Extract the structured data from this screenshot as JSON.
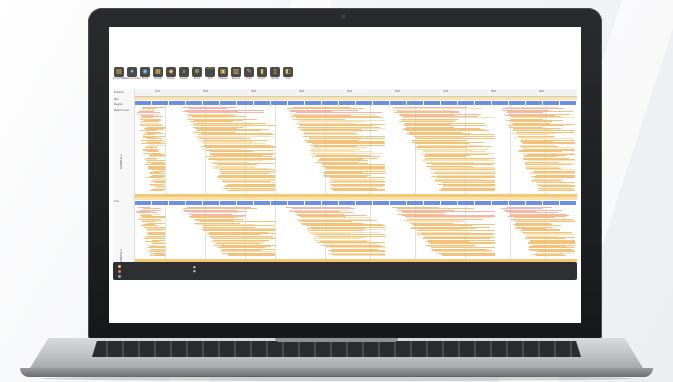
{
  "app": {
    "toolbar": [
      {
        "label": "Drug Files",
        "icon": "drug-files-icon",
        "glyph": "▤",
        "blue": false
      },
      {
        "label": "Reference Files",
        "icon": "reference-files-icon",
        "glyph": "●",
        "blue": true
      },
      {
        "label": "Scroll",
        "icon": "scroll-icon",
        "glyph": "◉",
        "blue": true
      },
      {
        "label": "Reads",
        "icon": "reads-icon",
        "glyph": "▦",
        "blue": false
      },
      {
        "label": "Screen",
        "icon": "screen-icon",
        "glyph": "◆",
        "blue": false
      },
      {
        "label": "Search",
        "icon": "search-icon",
        "glyph": "⌕",
        "blue": false
      },
      {
        "label": "Zoom",
        "icon": "zoom-icon",
        "glyph": "⊕",
        "blue": false
      },
      {
        "label": "Sort",
        "icon": "sort-icon",
        "glyph": "⌒",
        "blue": false
      },
      {
        "label": "Collapse",
        "icon": "collapse-icon",
        "glyph": "▣",
        "blue": false
      },
      {
        "label": "Expand",
        "icon": "expand-icon",
        "glyph": "▥",
        "blue": false
      },
      {
        "label": "Tools",
        "icon": "tools-icon",
        "glyph": "✎",
        "blue": false
      },
      {
        "label": "Export",
        "icon": "export-icon",
        "glyph": "▮",
        "blue": false
      },
      {
        "label": "Options",
        "icon": "options-icon",
        "glyph": "▯",
        "blue": false
      },
      {
        "label": "Help",
        "icon": "help-icon",
        "glyph": "◧",
        "blue": false
      }
    ],
    "version": "",
    "ruler_ticks": [
      "100",
      "200",
      "300",
      "400",
      "500",
      "600",
      "700",
      "800",
      "900"
    ],
    "left_labels": [
      "Position",
      "Ref",
      "Region",
      "Read Count",
      "Cov"
    ],
    "tracks": [
      "SAMPLE-1",
      "SAMPLE-2"
    ],
    "status": {
      "left": [
        {
          "key": "",
          "value": "",
          "color": "#f2c14e"
        },
        {
          "key": "",
          "value": "",
          "color": "#e07a5f"
        },
        {
          "key": "",
          "value": "",
          "color": "#81b29a"
        }
      ],
      "middle": "",
      "right": [
        {
          "key": "",
          "value": ""
        },
        {
          "key": "",
          "value": ""
        },
        {
          "key": "",
          "value": ""
        }
      ]
    }
  }
}
